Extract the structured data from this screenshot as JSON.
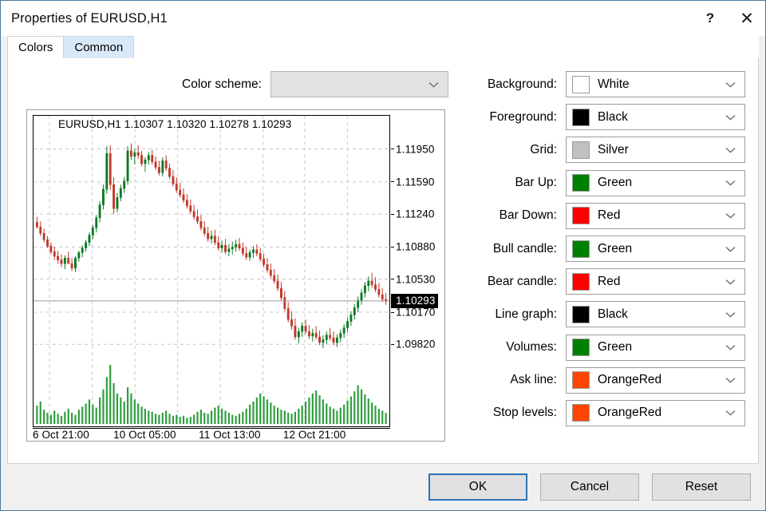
{
  "window": {
    "title": "Properties of EURUSD,H1",
    "help_glyph": "?",
    "close_glyph": "✕"
  },
  "tabs": [
    {
      "label": "Colors",
      "active": true
    },
    {
      "label": "Common",
      "active": false
    }
  ],
  "scheme": {
    "label": "Color scheme:",
    "value": "",
    "placeholder": ""
  },
  "color_rows": [
    {
      "label": "Background:",
      "value": "White",
      "hex": "#FFFFFF"
    },
    {
      "label": "Foreground:",
      "value": "Black",
      "hex": "#000000"
    },
    {
      "label": "Grid:",
      "value": "Silver",
      "hex": "#C0C0C0"
    },
    {
      "label": "Bar Up:",
      "value": "Green",
      "hex": "#008000"
    },
    {
      "label": "Bar Down:",
      "value": "Red",
      "hex": "#FF0000"
    },
    {
      "label": "Bull candle:",
      "value": "Green",
      "hex": "#008000"
    },
    {
      "label": "Bear candle:",
      "value": "Red",
      "hex": "#FF0000"
    },
    {
      "label": "Line graph:",
      "value": "Black",
      "hex": "#000000"
    },
    {
      "label": "Volumes:",
      "value": "Green",
      "hex": "#008000"
    },
    {
      "label": "Ask line:",
      "value": "OrangeRed",
      "hex": "#FF4500"
    },
    {
      "label": "Stop levels:",
      "value": "OrangeRed",
      "hex": "#FF4500"
    }
  ],
  "buttons": [
    {
      "label": "OK",
      "default": true
    },
    {
      "label": "Cancel",
      "default": false
    },
    {
      "label": "Reset",
      "default": false
    }
  ],
  "chart_data": {
    "type": "candlestick",
    "symbol": "EURUSD",
    "timeframe": "H1",
    "header": "EURUSD,H1  1.10307 1.10320 1.10278 1.10293",
    "ohlc": {
      "open": 1.10307,
      "high": 1.1032,
      "low": 1.10278,
      "close": 1.10293
    },
    "current_price": "1.10293",
    "grid": true,
    "ylim": [
      1.097,
      1.1212
    ],
    "price_ticks": [
      "1.11950",
      "1.11590",
      "1.11240",
      "1.10880",
      "1.10530",
      "1.10170",
      "1.09820"
    ],
    "price_tick_values": [
      1.1195,
      1.1159,
      1.1124,
      1.1088,
      1.1053,
      1.1017,
      1.0982
    ],
    "time_ticks": [
      "6 Oct 21:00",
      "10 Oct 05:00",
      "11 Oct 13:00",
      "12 Oct 21:00"
    ],
    "time_tick_x": [
      0.045,
      0.285,
      0.525,
      0.762
    ],
    "colors": {
      "bull": "#0a7a21",
      "bear": "#c0392b",
      "grid": "#c8c8c8",
      "volume": "#2e9e3e",
      "price_line": "#9a9a9a",
      "background": "#FFFFFF"
    },
    "candles": [
      {
        "o": 1.1115,
        "h": 1.1121,
        "l": 1.1108,
        "c": 1.111
      },
      {
        "o": 1.111,
        "h": 1.1116,
        "l": 1.11,
        "c": 1.1103
      },
      {
        "o": 1.1103,
        "h": 1.1108,
        "l": 1.1093,
        "c": 1.1096
      },
      {
        "o": 1.1096,
        "h": 1.11,
        "l": 1.1087,
        "c": 1.1089
      },
      {
        "o": 1.1089,
        "h": 1.1093,
        "l": 1.108,
        "c": 1.1083
      },
      {
        "o": 1.1083,
        "h": 1.1088,
        "l": 1.1074,
        "c": 1.1078
      },
      {
        "o": 1.1078,
        "h": 1.1084,
        "l": 1.107,
        "c": 1.1074
      },
      {
        "o": 1.1074,
        "h": 1.108,
        "l": 1.1066,
        "c": 1.107
      },
      {
        "o": 1.107,
        "h": 1.1079,
        "l": 1.1064,
        "c": 1.1076
      },
      {
        "o": 1.1076,
        "h": 1.1083,
        "l": 1.107,
        "c": 1.107
      },
      {
        "o": 1.107,
        "h": 1.1076,
        "l": 1.1062,
        "c": 1.1065
      },
      {
        "o": 1.1065,
        "h": 1.1078,
        "l": 1.1061,
        "c": 1.1076
      },
      {
        "o": 1.1076,
        "h": 1.1084,
        "l": 1.1072,
        "c": 1.1082
      },
      {
        "o": 1.1082,
        "h": 1.109,
        "l": 1.1077,
        "c": 1.1087
      },
      {
        "o": 1.1087,
        "h": 1.1096,
        "l": 1.1083,
        "c": 1.1093
      },
      {
        "o": 1.1093,
        "h": 1.1104,
        "l": 1.1089,
        "c": 1.1101
      },
      {
        "o": 1.1101,
        "h": 1.1112,
        "l": 1.1097,
        "c": 1.1109
      },
      {
        "o": 1.1109,
        "h": 1.1123,
        "l": 1.1104,
        "c": 1.112
      },
      {
        "o": 1.112,
        "h": 1.1138,
        "l": 1.1115,
        "c": 1.1134
      },
      {
        "o": 1.1134,
        "h": 1.1156,
        "l": 1.1129,
        "c": 1.1151
      },
      {
        "o": 1.1151,
        "h": 1.1198,
        "l": 1.1146,
        "c": 1.119
      },
      {
        "o": 1.119,
        "h": 1.1199,
        "l": 1.115,
        "c": 1.1156
      },
      {
        "o": 1.1156,
        "h": 1.1164,
        "l": 1.1124,
        "c": 1.113
      },
      {
        "o": 1.113,
        "h": 1.1147,
        "l": 1.1126,
        "c": 1.1142
      },
      {
        "o": 1.1142,
        "h": 1.1156,
        "l": 1.1138,
        "c": 1.1152
      },
      {
        "o": 1.1152,
        "h": 1.1164,
        "l": 1.1147,
        "c": 1.116
      },
      {
        "o": 1.116,
        "h": 1.1198,
        "l": 1.1156,
        "c": 1.1193
      },
      {
        "o": 1.1193,
        "h": 1.1201,
        "l": 1.1183,
        "c": 1.1187
      },
      {
        "o": 1.1187,
        "h": 1.1195,
        "l": 1.1178,
        "c": 1.1191
      },
      {
        "o": 1.1191,
        "h": 1.1199,
        "l": 1.1184,
        "c": 1.1188
      },
      {
        "o": 1.1188,
        "h": 1.1193,
        "l": 1.1176,
        "c": 1.1179
      },
      {
        "o": 1.1179,
        "h": 1.1186,
        "l": 1.117,
        "c": 1.1183
      },
      {
        "o": 1.1183,
        "h": 1.1192,
        "l": 1.1178,
        "c": 1.1188
      },
      {
        "o": 1.1188,
        "h": 1.1194,
        "l": 1.1178,
        "c": 1.1181
      },
      {
        "o": 1.1181,
        "h": 1.1187,
        "l": 1.1172,
        "c": 1.1175
      },
      {
        "o": 1.1175,
        "h": 1.1182,
        "l": 1.1166,
        "c": 1.1169
      },
      {
        "o": 1.1169,
        "h": 1.1186,
        "l": 1.1165,
        "c": 1.1182
      },
      {
        "o": 1.1182,
        "h": 1.1188,
        "l": 1.1171,
        "c": 1.1174
      },
      {
        "o": 1.1174,
        "h": 1.1179,
        "l": 1.1162,
        "c": 1.1165
      },
      {
        "o": 1.1165,
        "h": 1.1172,
        "l": 1.1154,
        "c": 1.1157
      },
      {
        "o": 1.1157,
        "h": 1.1164,
        "l": 1.1147,
        "c": 1.115
      },
      {
        "o": 1.115,
        "h": 1.1158,
        "l": 1.1142,
        "c": 1.1145
      },
      {
        "o": 1.1145,
        "h": 1.1152,
        "l": 1.1136,
        "c": 1.1139
      },
      {
        "o": 1.1139,
        "h": 1.1146,
        "l": 1.113,
        "c": 1.1133
      },
      {
        "o": 1.1133,
        "h": 1.114,
        "l": 1.1124,
        "c": 1.1127
      },
      {
        "o": 1.1127,
        "h": 1.1134,
        "l": 1.1118,
        "c": 1.1121
      },
      {
        "o": 1.1121,
        "h": 1.1129,
        "l": 1.1113,
        "c": 1.1116
      },
      {
        "o": 1.1116,
        "h": 1.1123,
        "l": 1.1106,
        "c": 1.1109
      },
      {
        "o": 1.1109,
        "h": 1.1116,
        "l": 1.11,
        "c": 1.1103
      },
      {
        "o": 1.1103,
        "h": 1.111,
        "l": 1.1094,
        "c": 1.1097
      },
      {
        "o": 1.1097,
        "h": 1.1106,
        "l": 1.1092,
        "c": 1.11
      },
      {
        "o": 1.11,
        "h": 1.1107,
        "l": 1.109,
        "c": 1.1093
      },
      {
        "o": 1.1093,
        "h": 1.11,
        "l": 1.1084,
        "c": 1.1087
      },
      {
        "o": 1.1087,
        "h": 1.1095,
        "l": 1.1082,
        "c": 1.109
      },
      {
        "o": 1.109,
        "h": 1.1097,
        "l": 1.108,
        "c": 1.1083
      },
      {
        "o": 1.1083,
        "h": 1.1091,
        "l": 1.1078,
        "c": 1.1086
      },
      {
        "o": 1.1086,
        "h": 1.1094,
        "l": 1.108,
        "c": 1.1088
      },
      {
        "o": 1.1088,
        "h": 1.1096,
        "l": 1.1083,
        "c": 1.1091
      },
      {
        "o": 1.1091,
        "h": 1.1098,
        "l": 1.1084,
        "c": 1.1087
      },
      {
        "o": 1.1087,
        "h": 1.1093,
        "l": 1.1078,
        "c": 1.1081
      },
      {
        "o": 1.1081,
        "h": 1.1088,
        "l": 1.1074,
        "c": 1.1077
      },
      {
        "o": 1.1077,
        "h": 1.1085,
        "l": 1.1073,
        "c": 1.1082
      },
      {
        "o": 1.1082,
        "h": 1.1089,
        "l": 1.1076,
        "c": 1.1085
      },
      {
        "o": 1.1085,
        "h": 1.1091,
        "l": 1.1078,
        "c": 1.1081
      },
      {
        "o": 1.1081,
        "h": 1.1087,
        "l": 1.1072,
        "c": 1.1075
      },
      {
        "o": 1.1075,
        "h": 1.1081,
        "l": 1.1066,
        "c": 1.1069
      },
      {
        "o": 1.1069,
        "h": 1.1076,
        "l": 1.106,
        "c": 1.1063
      },
      {
        "o": 1.1063,
        "h": 1.107,
        "l": 1.1054,
        "c": 1.1057
      },
      {
        "o": 1.1057,
        "h": 1.1064,
        "l": 1.1048,
        "c": 1.1051
      },
      {
        "o": 1.1051,
        "h": 1.1058,
        "l": 1.104,
        "c": 1.1043
      },
      {
        "o": 1.1043,
        "h": 1.105,
        "l": 1.103,
        "c": 1.1033
      },
      {
        "o": 1.1033,
        "h": 1.104,
        "l": 1.1018,
        "c": 1.1021
      },
      {
        "o": 1.1021,
        "h": 1.1028,
        "l": 1.1006,
        "c": 1.1009
      },
      {
        "o": 1.1009,
        "h": 1.1018,
        "l": 1.0998,
        "c": 1.1002
      },
      {
        "o": 1.1002,
        "h": 1.101,
        "l": 1.0987,
        "c": 1.099
      },
      {
        "o": 1.099,
        "h": 1.1,
        "l": 1.0983,
        "c": 1.0996
      },
      {
        "o": 1.0996,
        "h": 1.1006,
        "l": 1.099,
        "c": 1.1002
      },
      {
        "o": 1.1002,
        "h": 1.1009,
        "l": 1.0993,
        "c": 1.0996
      },
      {
        "o": 1.0996,
        "h": 1.1003,
        "l": 1.0988,
        "c": 1.0991
      },
      {
        "o": 1.0991,
        "h": 1.0999,
        "l": 1.0985,
        "c": 1.0994
      },
      {
        "o": 1.0994,
        "h": 1.1002,
        "l": 1.0987,
        "c": 1.099
      },
      {
        "o": 1.099,
        "h": 1.0997,
        "l": 1.0981,
        "c": 1.0984
      },
      {
        "o": 1.0984,
        "h": 1.0992,
        "l": 1.0978,
        "c": 1.0987
      },
      {
        "o": 1.0987,
        "h": 1.0996,
        "l": 1.0982,
        "c": 1.0992
      },
      {
        "o": 1.0992,
        "h": 1.1,
        "l": 1.0986,
        "c": 1.0989
      },
      {
        "o": 1.0989,
        "h": 1.0996,
        "l": 1.0981,
        "c": 1.0984
      },
      {
        "o": 1.0984,
        "h": 1.0993,
        "l": 1.0979,
        "c": 1.0989
      },
      {
        "o": 1.0989,
        "h": 1.0998,
        "l": 1.0984,
        "c": 1.0994
      },
      {
        "o": 1.0994,
        "h": 1.1004,
        "l": 1.0989,
        "c": 1.1
      },
      {
        "o": 1.1,
        "h": 1.1011,
        "l": 1.0995,
        "c": 1.1007
      },
      {
        "o": 1.1007,
        "h": 1.1018,
        "l": 1.1002,
        "c": 1.1014
      },
      {
        "o": 1.1014,
        "h": 1.1026,
        "l": 1.1009,
        "c": 1.1022
      },
      {
        "o": 1.1022,
        "h": 1.1034,
        "l": 1.1017,
        "c": 1.103
      },
      {
        "o": 1.103,
        "h": 1.1042,
        "l": 1.1025,
        "c": 1.1038
      },
      {
        "o": 1.1038,
        "h": 1.105,
        "l": 1.1033,
        "c": 1.1046
      },
      {
        "o": 1.1046,
        "h": 1.1056,
        "l": 1.104,
        "c": 1.1051
      },
      {
        "o": 1.1051,
        "h": 1.106,
        "l": 1.1044,
        "c": 1.1047
      },
      {
        "o": 1.1047,
        "h": 1.1055,
        "l": 1.1039,
        "c": 1.1042
      },
      {
        "o": 1.1042,
        "h": 1.1049,
        "l": 1.1033,
        "c": 1.1036
      },
      {
        "o": 1.1036,
        "h": 1.1043,
        "l": 1.1028,
        "c": 1.1031
      },
      {
        "o": 1.1031,
        "h": 1.1038,
        "l": 1.1025,
        "c": 1.10293
      }
    ],
    "volumes": [
      18,
      22,
      14,
      11,
      9,
      13,
      10,
      8,
      12,
      15,
      11,
      9,
      14,
      17,
      20,
      24,
      19,
      16,
      26,
      34,
      46,
      58,
      40,
      30,
      26,
      22,
      36,
      30,
      24,
      20,
      17,
      15,
      13,
      12,
      10,
      9,
      11,
      13,
      10,
      8,
      9,
      7,
      8,
      6,
      7,
      9,
      12,
      14,
      11,
      10,
      13,
      16,
      18,
      15,
      13,
      11,
      9,
      8,
      10,
      12,
      15,
      19,
      22,
      26,
      30,
      27,
      24,
      21,
      18,
      16,
      14,
      13,
      11,
      10,
      12,
      15,
      18,
      22,
      26,
      30,
      33,
      28,
      24,
      20,
      17,
      15,
      13,
      16,
      19,
      23,
      27,
      32,
      38,
      34,
      29,
      25,
      21,
      18,
      15,
      13,
      11
    ]
  }
}
